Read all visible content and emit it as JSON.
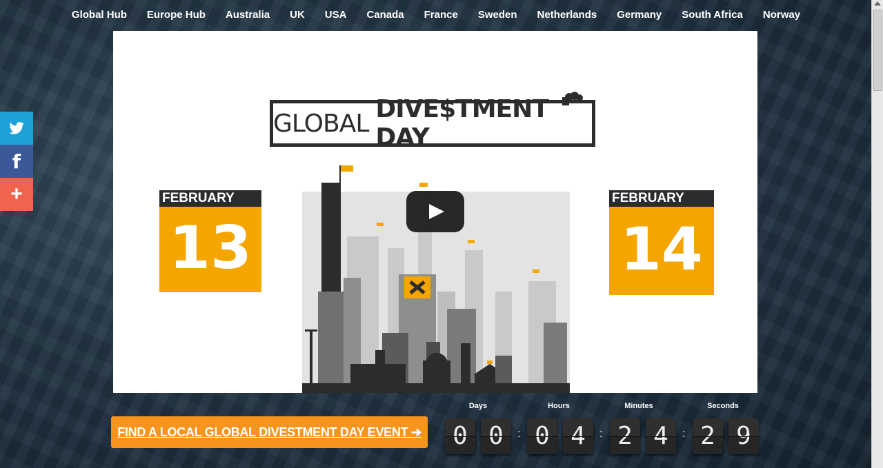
{
  "nav": {
    "items": [
      "Global Hub",
      "Europe Hub",
      "Australia",
      "UK",
      "USA",
      "Canada",
      "France",
      "Sweden",
      "Netherlands",
      "Germany",
      "South Africa",
      "Norway"
    ]
  },
  "social": {
    "twitter_icon": "twitter-icon",
    "facebook_icon": "facebook-icon",
    "share_icon": "plus-icon",
    "facebook_glyph": "f",
    "plus_glyph": "+"
  },
  "video": {
    "logo_text_1": "GLOBAL",
    "logo_text_2": "DIVE$TMENT DAY",
    "left_calendar": {
      "month": "FEBRUARY",
      "day": "13"
    },
    "right_calendar": {
      "month": "FEBRUARY",
      "day": "14"
    },
    "play_icon": "play-icon"
  },
  "cta": {
    "label": "FIND A LOCAL GLOBAL DIVESTMENT DAY EVENT ➔"
  },
  "countdown": {
    "days_label": "Days",
    "hours_label": "Hours",
    "minutes_label": "Minutes",
    "seconds_label": "Seconds",
    "days": [
      "0",
      "0"
    ],
    "hours": [
      "0",
      "4"
    ],
    "minutes": [
      "2",
      "4"
    ],
    "seconds": [
      "2",
      "9"
    ]
  },
  "colors": {
    "accent_orange": "#f6941d",
    "calendar_orange": "#f5a500",
    "twitter": "#1da1d7",
    "facebook": "#3b5898",
    "share": "#f0644d"
  }
}
